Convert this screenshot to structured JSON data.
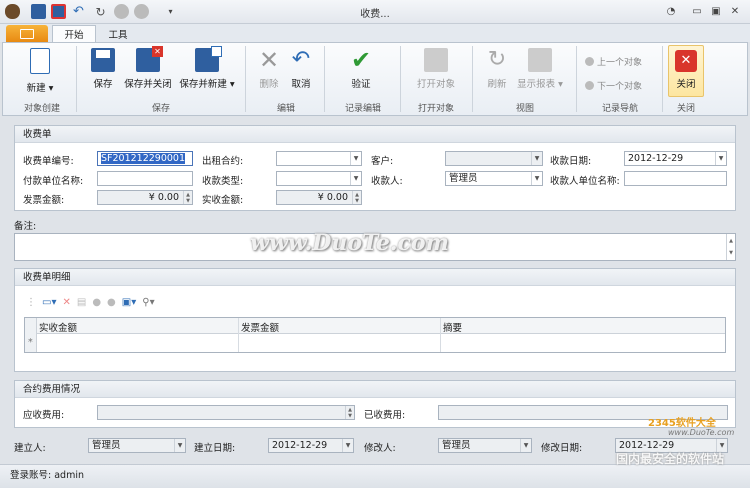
{
  "window": {
    "title": "收费..."
  },
  "tabs": {
    "home": "开始",
    "tools": "工具"
  },
  "ribbon": {
    "new_label": "新建",
    "save_label": "保存",
    "save_close_label": "保存并关闭",
    "save_new_label": "保存并新建",
    "delete_label": "删除",
    "cancel_label": "取消",
    "validate_label": "验证",
    "open_object_label": "打开对象",
    "refresh_label": "刷新",
    "show_report_label": "显示报表",
    "prev_object_label": "上一个对象",
    "next_object_label": "下一个对象",
    "close_label": "关闭",
    "groups": {
      "create": "对象创建",
      "save": "保存",
      "edit": "编辑",
      "record_edit": "记录编辑",
      "open_object": "打开对象",
      "view": "视图",
      "record_nav": "记录导航",
      "close": "关闭"
    }
  },
  "receipt": {
    "header": "收费单",
    "number_label": "收费单编号:",
    "number_value": "SF201212290001",
    "contract_label": "出租合约:",
    "contract_value": "",
    "customer_label": "客户:",
    "customer_value": "",
    "date_label": "收款日期:",
    "date_value": "2012-12-29",
    "payer_label": "付款单位名称:",
    "payer_value": "",
    "type_label": "收款类型:",
    "type_value": "",
    "payee_label": "收款人:",
    "payee_value": "管理员",
    "payee_org_label": "收款人单位名称:",
    "payee_org_value": "",
    "invoice_amount_label": "发票金额:",
    "invoice_amount_value": "¥ 0.00",
    "actual_amount_label": "实收金额:",
    "actual_amount_value": "¥ 0.00"
  },
  "remarks": {
    "label": "备注:",
    "value": ""
  },
  "detail": {
    "header": "收费单明细",
    "columns": [
      "实收金额",
      "发票金额",
      "摘要"
    ],
    "new_row_marker": "*"
  },
  "contract_fees": {
    "header": "合约费用情况",
    "receivable_label": "应收费用:",
    "receivable_value": "",
    "received_label": "已收费用:",
    "received_value": ""
  },
  "audit": {
    "creator_label": "建立人:",
    "creator_value": "管理员",
    "created_date_label": "建立日期:",
    "created_date_value": "2012-12-29",
    "modifier_label": "修改人:",
    "modifier_value": "管理员",
    "modified_date_label": "修改日期:",
    "modified_date_value": "2012-12-29"
  },
  "status": {
    "login": "登录账号: admin"
  },
  "watermarks": {
    "center": "www.DuoTe.com",
    "corner_brand": "2345软件大全",
    "corner_url": "www.DuoTe.com",
    "corner_slogan": "国内最安全的软件站"
  },
  "colors": {
    "accent_orange": "#f0a22a",
    "close_red": "#d9352b",
    "validate_green": "#2f9a35",
    "blue_icon": "#2f6db5"
  }
}
